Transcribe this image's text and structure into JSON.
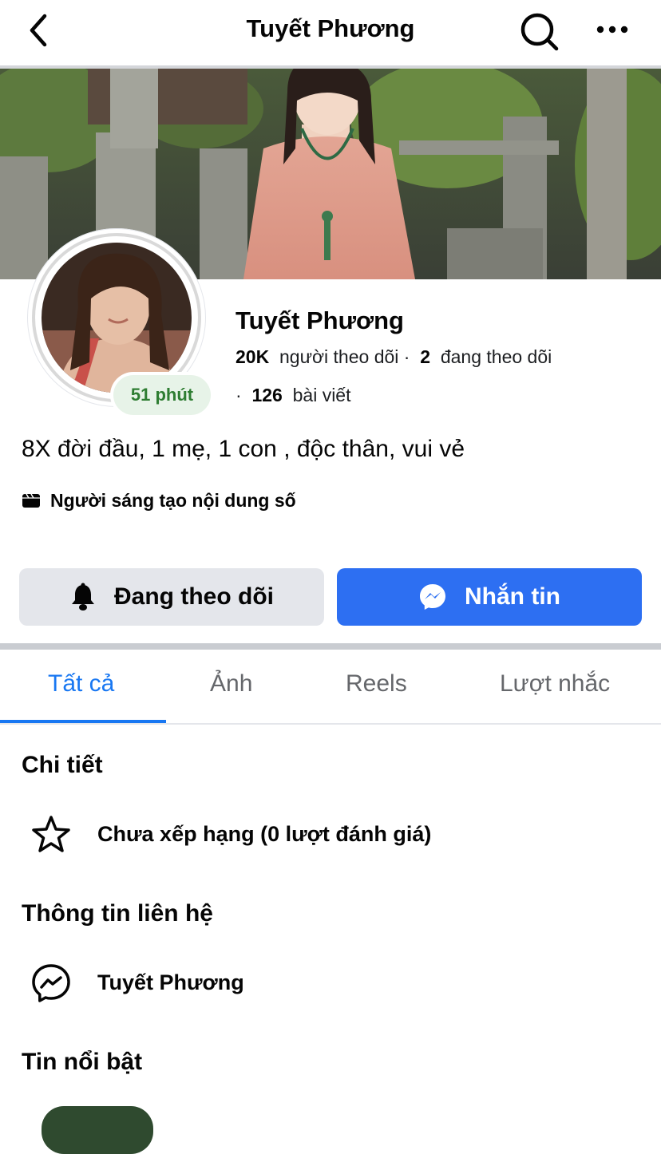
{
  "header": {
    "title": "Tuyết Phương"
  },
  "profile": {
    "name": "Tuyết Phương",
    "active_badge": "51 phút",
    "followers_count": "20K",
    "followers_label": "người theo dõi",
    "dot": "·",
    "following_count": "2",
    "following_label": "đang theo dõi",
    "posts_count": "126",
    "posts_label": "bài viết",
    "bio": "8X đời đầu, 1 mẹ, 1 con , độc thân, vui vẻ",
    "category": "Người sáng tạo nội dung số"
  },
  "actions": {
    "follow_label": "Đang theo dõi",
    "message_label": "Nhắn tin"
  },
  "tabs": [
    {
      "label": "Tất cả",
      "active": true
    },
    {
      "label": "Ảnh",
      "active": false
    },
    {
      "label": "Reels",
      "active": false
    },
    {
      "label": "Lượt nhắc",
      "active": false
    }
  ],
  "details": {
    "heading": "Chi tiết",
    "rating_text": "Chưa xếp hạng (0 lượt đánh giá)"
  },
  "contact": {
    "heading": "Thông tin liên hệ",
    "messenger_name": "Tuyết Phương"
  },
  "highlights": {
    "heading": "Tin nổi bật"
  },
  "colors": {
    "accent": "#1877f2",
    "message_button": "#2d6ff2",
    "active_badge_bg": "#e7f3e8",
    "active_badge_text": "#2e7d32"
  },
  "icons": {
    "back": "chevron-left-icon",
    "search": "search-icon",
    "more": "more-horizontal-icon",
    "bell": "bell-icon",
    "messenger": "messenger-icon",
    "category": "clapperboard-icon",
    "star": "star-icon"
  }
}
